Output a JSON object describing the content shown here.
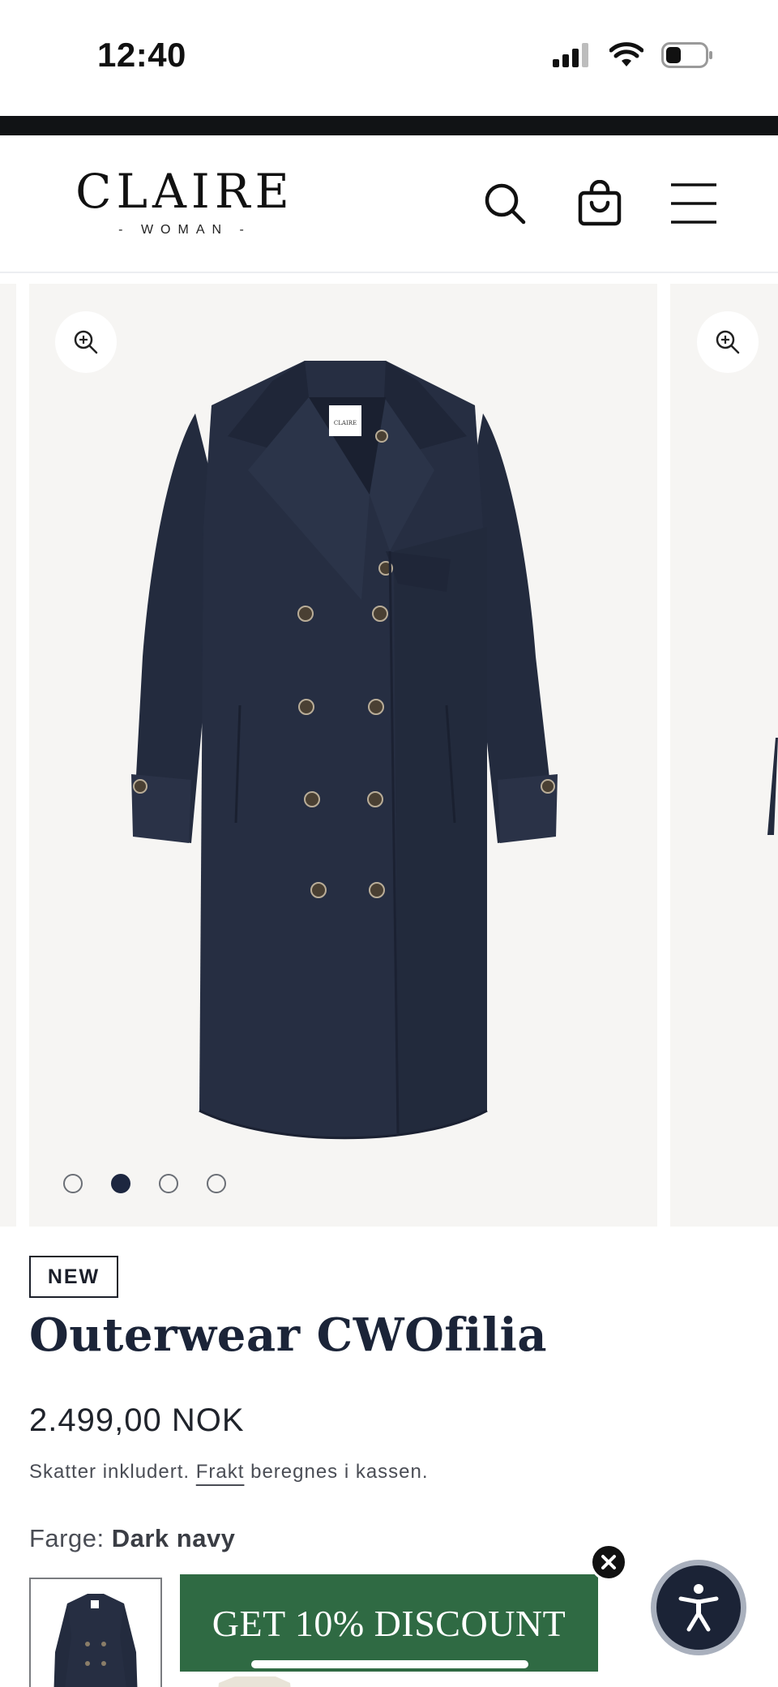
{
  "status_bar": {
    "time": "12:40"
  },
  "header": {
    "logo_main": "CLAIRE",
    "logo_sub": "- WOMAN -",
    "icons": [
      "search-icon",
      "shopping-bag-icon",
      "menu-icon"
    ]
  },
  "gallery": {
    "image_label": "CLAIRE",
    "slide_count": 4,
    "active_slide": 2
  },
  "product": {
    "badge": "NEW",
    "title": "Outerwear CWOfilia",
    "price": "2.499,00 NOK",
    "tax_before": "Skatter inkludert. ",
    "tax_link": "Frakt",
    "tax_after": " beregnes i kassen.",
    "color_label": "Farge: ",
    "color_value": "Dark navy"
  },
  "discount": {
    "label": "GET 10% DISCOUNT"
  },
  "colors": {
    "accent_green": "#2f6a43",
    "navy": "#1b2438"
  }
}
